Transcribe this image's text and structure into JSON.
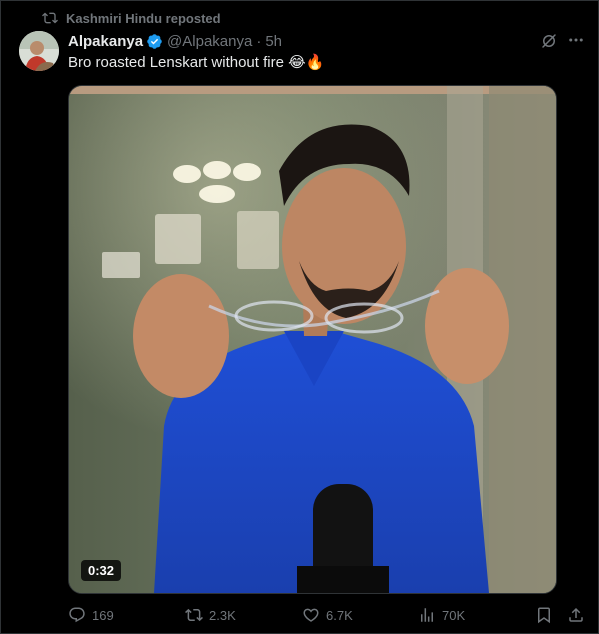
{
  "repost": {
    "label": "Kashmiri Hindu reposted"
  },
  "author": {
    "display_name": "Alpakanya",
    "handle": "@Alpakanya",
    "separator": "·",
    "time": "5h"
  },
  "tweet": {
    "text": "Bro roasted Lenskart without fire 😂🔥"
  },
  "media": {
    "duration": "0:32",
    "progress": 0.0
  },
  "actions": {
    "replies": "169",
    "reposts": "2.3K",
    "likes": "6.7K",
    "views": "70K"
  },
  "colors": {
    "accent": "#1d9bf0",
    "muted": "#71767b",
    "text": "#e7e9ea",
    "background": "#000000"
  }
}
